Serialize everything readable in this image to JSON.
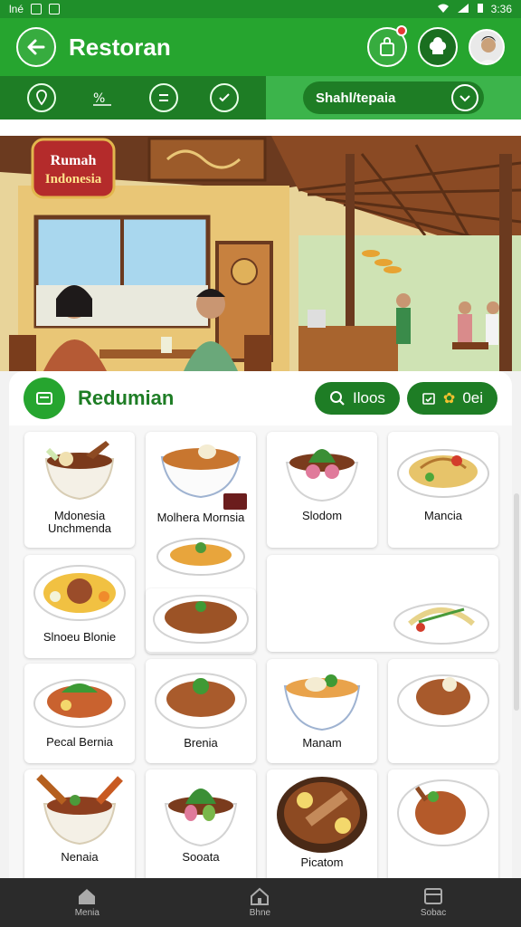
{
  "status": {
    "left_text": "lné",
    "time": "3:36"
  },
  "header": {
    "title": "Restoran"
  },
  "subbar": {
    "selector_label": "Shahl/tepaia"
  },
  "hero": {
    "sign_line1": "Rumah",
    "sign_line2": "Indonesia"
  },
  "section": {
    "title": "Redumian",
    "search_chip": "Iloos",
    "filter_chip": "0ei"
  },
  "dishes": [
    {
      "label": "Mdonesia Unchmenda"
    },
    {
      "label": "Molhera Mornsia"
    },
    {
      "label": "Slodom"
    },
    {
      "label": "Mancia"
    },
    {
      "label": "Slnoeu Blonie"
    },
    {
      "label": ""
    },
    {
      "label": ""
    },
    {
      "label": "Pecal Bernia"
    },
    {
      "label": "Brenia"
    },
    {
      "label": "Manam"
    },
    {
      "label": ""
    },
    {
      "label": "Nenaia"
    },
    {
      "label": "Sooata"
    },
    {
      "label": "Picatom"
    },
    {
      "label": ""
    }
  ],
  "bottom_nav": [
    {
      "label": "Menia"
    },
    {
      "label": "Bhne"
    },
    {
      "label": "Sobac"
    }
  ],
  "colors": {
    "brand": "#26a52f",
    "brand_dark": "#1e7d25"
  }
}
